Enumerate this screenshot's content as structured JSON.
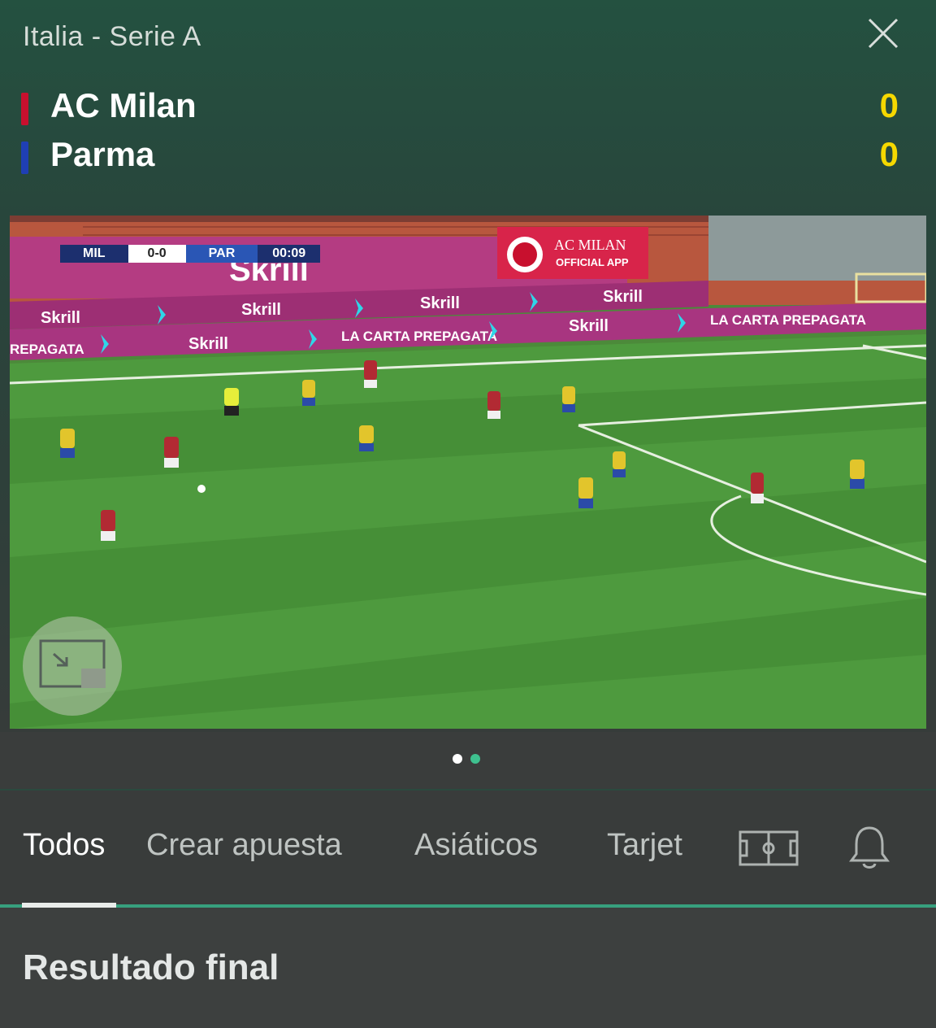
{
  "header": {
    "competition": "Italia - Serie A",
    "close_icon": "close-icon"
  },
  "match": {
    "home": {
      "name": "AC Milan",
      "score": "0",
      "color": "#c8102e"
    },
    "away": {
      "name": "Parma",
      "score": "0",
      "color": "#1f3fb4"
    }
  },
  "video": {
    "scorebug": {
      "home": "MIL",
      "score": "0-0",
      "away": "PAR",
      "time": "00:09"
    },
    "board_texts": [
      "Skrill",
      "LA CARTA PREPAGATA",
      "AC MILAN OFFICIAL APP"
    ],
    "pip_icon": "picture-in-picture-icon"
  },
  "carousel": {
    "count": 2,
    "active_index": 1,
    "active_color": "#3ec18f",
    "inactive_color": "#ffffff"
  },
  "tabs": [
    {
      "label": "Todos",
      "active": true
    },
    {
      "label": "Crear apuesta",
      "active": false
    },
    {
      "label": "Asiáticos",
      "active": false
    },
    {
      "label": "Tarjet",
      "active": false
    }
  ],
  "tab_icons": [
    "pitch-icon",
    "bell-icon"
  ],
  "market": {
    "title": "Resultado final"
  },
  "colors": {
    "accent": "#37a07e",
    "score": "#f5d800",
    "background": "#3a3d3c"
  }
}
